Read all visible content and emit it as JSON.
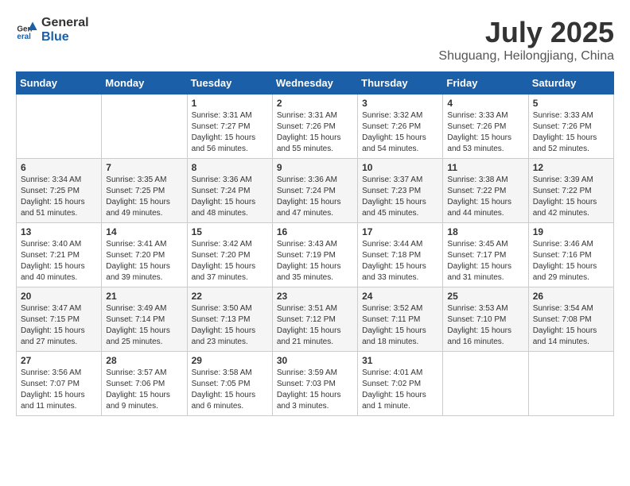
{
  "header": {
    "logo_general": "General",
    "logo_blue": "Blue",
    "month": "July 2025",
    "location": "Shuguang, Heilongjiang, China"
  },
  "days_of_week": [
    "Sunday",
    "Monday",
    "Tuesday",
    "Wednesday",
    "Thursday",
    "Friday",
    "Saturday"
  ],
  "weeks": [
    [
      {
        "day": "",
        "info": ""
      },
      {
        "day": "",
        "info": ""
      },
      {
        "day": "1",
        "info": "Sunrise: 3:31 AM\nSunset: 7:27 PM\nDaylight: 15 hours\nand 56 minutes."
      },
      {
        "day": "2",
        "info": "Sunrise: 3:31 AM\nSunset: 7:26 PM\nDaylight: 15 hours\nand 55 minutes."
      },
      {
        "day": "3",
        "info": "Sunrise: 3:32 AM\nSunset: 7:26 PM\nDaylight: 15 hours\nand 54 minutes."
      },
      {
        "day": "4",
        "info": "Sunrise: 3:33 AM\nSunset: 7:26 PM\nDaylight: 15 hours\nand 53 minutes."
      },
      {
        "day": "5",
        "info": "Sunrise: 3:33 AM\nSunset: 7:26 PM\nDaylight: 15 hours\nand 52 minutes."
      }
    ],
    [
      {
        "day": "6",
        "info": "Sunrise: 3:34 AM\nSunset: 7:25 PM\nDaylight: 15 hours\nand 51 minutes."
      },
      {
        "day": "7",
        "info": "Sunrise: 3:35 AM\nSunset: 7:25 PM\nDaylight: 15 hours\nand 49 minutes."
      },
      {
        "day": "8",
        "info": "Sunrise: 3:36 AM\nSunset: 7:24 PM\nDaylight: 15 hours\nand 48 minutes."
      },
      {
        "day": "9",
        "info": "Sunrise: 3:36 AM\nSunset: 7:24 PM\nDaylight: 15 hours\nand 47 minutes."
      },
      {
        "day": "10",
        "info": "Sunrise: 3:37 AM\nSunset: 7:23 PM\nDaylight: 15 hours\nand 45 minutes."
      },
      {
        "day": "11",
        "info": "Sunrise: 3:38 AM\nSunset: 7:22 PM\nDaylight: 15 hours\nand 44 minutes."
      },
      {
        "day": "12",
        "info": "Sunrise: 3:39 AM\nSunset: 7:22 PM\nDaylight: 15 hours\nand 42 minutes."
      }
    ],
    [
      {
        "day": "13",
        "info": "Sunrise: 3:40 AM\nSunset: 7:21 PM\nDaylight: 15 hours\nand 40 minutes."
      },
      {
        "day": "14",
        "info": "Sunrise: 3:41 AM\nSunset: 7:20 PM\nDaylight: 15 hours\nand 39 minutes."
      },
      {
        "day": "15",
        "info": "Sunrise: 3:42 AM\nSunset: 7:20 PM\nDaylight: 15 hours\nand 37 minutes."
      },
      {
        "day": "16",
        "info": "Sunrise: 3:43 AM\nSunset: 7:19 PM\nDaylight: 15 hours\nand 35 minutes."
      },
      {
        "day": "17",
        "info": "Sunrise: 3:44 AM\nSunset: 7:18 PM\nDaylight: 15 hours\nand 33 minutes."
      },
      {
        "day": "18",
        "info": "Sunrise: 3:45 AM\nSunset: 7:17 PM\nDaylight: 15 hours\nand 31 minutes."
      },
      {
        "day": "19",
        "info": "Sunrise: 3:46 AM\nSunset: 7:16 PM\nDaylight: 15 hours\nand 29 minutes."
      }
    ],
    [
      {
        "day": "20",
        "info": "Sunrise: 3:47 AM\nSunset: 7:15 PM\nDaylight: 15 hours\nand 27 minutes."
      },
      {
        "day": "21",
        "info": "Sunrise: 3:49 AM\nSunset: 7:14 PM\nDaylight: 15 hours\nand 25 minutes."
      },
      {
        "day": "22",
        "info": "Sunrise: 3:50 AM\nSunset: 7:13 PM\nDaylight: 15 hours\nand 23 minutes."
      },
      {
        "day": "23",
        "info": "Sunrise: 3:51 AM\nSunset: 7:12 PM\nDaylight: 15 hours\nand 21 minutes."
      },
      {
        "day": "24",
        "info": "Sunrise: 3:52 AM\nSunset: 7:11 PM\nDaylight: 15 hours\nand 18 minutes."
      },
      {
        "day": "25",
        "info": "Sunrise: 3:53 AM\nSunset: 7:10 PM\nDaylight: 15 hours\nand 16 minutes."
      },
      {
        "day": "26",
        "info": "Sunrise: 3:54 AM\nSunset: 7:08 PM\nDaylight: 15 hours\nand 14 minutes."
      }
    ],
    [
      {
        "day": "27",
        "info": "Sunrise: 3:56 AM\nSunset: 7:07 PM\nDaylight: 15 hours\nand 11 minutes."
      },
      {
        "day": "28",
        "info": "Sunrise: 3:57 AM\nSunset: 7:06 PM\nDaylight: 15 hours\nand 9 minutes."
      },
      {
        "day": "29",
        "info": "Sunrise: 3:58 AM\nSunset: 7:05 PM\nDaylight: 15 hours\nand 6 minutes."
      },
      {
        "day": "30",
        "info": "Sunrise: 3:59 AM\nSunset: 7:03 PM\nDaylight: 15 hours\nand 3 minutes."
      },
      {
        "day": "31",
        "info": "Sunrise: 4:01 AM\nSunset: 7:02 PM\nDaylight: 15 hours\nand 1 minute."
      },
      {
        "day": "",
        "info": ""
      },
      {
        "day": "",
        "info": ""
      }
    ]
  ]
}
